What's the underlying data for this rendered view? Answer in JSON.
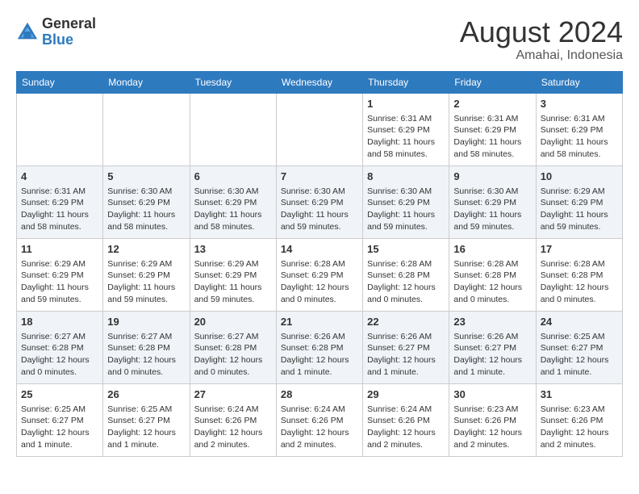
{
  "header": {
    "logo_general": "General",
    "logo_blue": "Blue",
    "title": "August 2024",
    "subtitle": "Amahai, Indonesia"
  },
  "days_of_week": [
    "Sunday",
    "Monday",
    "Tuesday",
    "Wednesday",
    "Thursday",
    "Friday",
    "Saturday"
  ],
  "weeks": [
    [
      {
        "day": "",
        "info": ""
      },
      {
        "day": "",
        "info": ""
      },
      {
        "day": "",
        "info": ""
      },
      {
        "day": "",
        "info": ""
      },
      {
        "day": "1",
        "info": "Sunrise: 6:31 AM\nSunset: 6:29 PM\nDaylight: 11 hours\nand 58 minutes."
      },
      {
        "day": "2",
        "info": "Sunrise: 6:31 AM\nSunset: 6:29 PM\nDaylight: 11 hours\nand 58 minutes."
      },
      {
        "day": "3",
        "info": "Sunrise: 6:31 AM\nSunset: 6:29 PM\nDaylight: 11 hours\nand 58 minutes."
      }
    ],
    [
      {
        "day": "4",
        "info": "Sunrise: 6:31 AM\nSunset: 6:29 PM\nDaylight: 11 hours\nand 58 minutes."
      },
      {
        "day": "5",
        "info": "Sunrise: 6:30 AM\nSunset: 6:29 PM\nDaylight: 11 hours\nand 58 minutes."
      },
      {
        "day": "6",
        "info": "Sunrise: 6:30 AM\nSunset: 6:29 PM\nDaylight: 11 hours\nand 58 minutes."
      },
      {
        "day": "7",
        "info": "Sunrise: 6:30 AM\nSunset: 6:29 PM\nDaylight: 11 hours\nand 59 minutes."
      },
      {
        "day": "8",
        "info": "Sunrise: 6:30 AM\nSunset: 6:29 PM\nDaylight: 11 hours\nand 59 minutes."
      },
      {
        "day": "9",
        "info": "Sunrise: 6:30 AM\nSunset: 6:29 PM\nDaylight: 11 hours\nand 59 minutes."
      },
      {
        "day": "10",
        "info": "Sunrise: 6:29 AM\nSunset: 6:29 PM\nDaylight: 11 hours\nand 59 minutes."
      }
    ],
    [
      {
        "day": "11",
        "info": "Sunrise: 6:29 AM\nSunset: 6:29 PM\nDaylight: 11 hours\nand 59 minutes."
      },
      {
        "day": "12",
        "info": "Sunrise: 6:29 AM\nSunset: 6:29 PM\nDaylight: 11 hours\nand 59 minutes."
      },
      {
        "day": "13",
        "info": "Sunrise: 6:29 AM\nSunset: 6:29 PM\nDaylight: 11 hours\nand 59 minutes."
      },
      {
        "day": "14",
        "info": "Sunrise: 6:28 AM\nSunset: 6:29 PM\nDaylight: 12 hours\nand 0 minutes."
      },
      {
        "day": "15",
        "info": "Sunrise: 6:28 AM\nSunset: 6:28 PM\nDaylight: 12 hours\nand 0 minutes."
      },
      {
        "day": "16",
        "info": "Sunrise: 6:28 AM\nSunset: 6:28 PM\nDaylight: 12 hours\nand 0 minutes."
      },
      {
        "day": "17",
        "info": "Sunrise: 6:28 AM\nSunset: 6:28 PM\nDaylight: 12 hours\nand 0 minutes."
      }
    ],
    [
      {
        "day": "18",
        "info": "Sunrise: 6:27 AM\nSunset: 6:28 PM\nDaylight: 12 hours\nand 0 minutes."
      },
      {
        "day": "19",
        "info": "Sunrise: 6:27 AM\nSunset: 6:28 PM\nDaylight: 12 hours\nand 0 minutes."
      },
      {
        "day": "20",
        "info": "Sunrise: 6:27 AM\nSunset: 6:28 PM\nDaylight: 12 hours\nand 0 minutes."
      },
      {
        "day": "21",
        "info": "Sunrise: 6:26 AM\nSunset: 6:28 PM\nDaylight: 12 hours\nand 1 minute."
      },
      {
        "day": "22",
        "info": "Sunrise: 6:26 AM\nSunset: 6:27 PM\nDaylight: 12 hours\nand 1 minute."
      },
      {
        "day": "23",
        "info": "Sunrise: 6:26 AM\nSunset: 6:27 PM\nDaylight: 12 hours\nand 1 minute."
      },
      {
        "day": "24",
        "info": "Sunrise: 6:25 AM\nSunset: 6:27 PM\nDaylight: 12 hours\nand 1 minute."
      }
    ],
    [
      {
        "day": "25",
        "info": "Sunrise: 6:25 AM\nSunset: 6:27 PM\nDaylight: 12 hours\nand 1 minute."
      },
      {
        "day": "26",
        "info": "Sunrise: 6:25 AM\nSunset: 6:27 PM\nDaylight: 12 hours\nand 1 minute."
      },
      {
        "day": "27",
        "info": "Sunrise: 6:24 AM\nSunset: 6:26 PM\nDaylight: 12 hours\nand 2 minutes."
      },
      {
        "day": "28",
        "info": "Sunrise: 6:24 AM\nSunset: 6:26 PM\nDaylight: 12 hours\nand 2 minutes."
      },
      {
        "day": "29",
        "info": "Sunrise: 6:24 AM\nSunset: 6:26 PM\nDaylight: 12 hours\nand 2 minutes."
      },
      {
        "day": "30",
        "info": "Sunrise: 6:23 AM\nSunset: 6:26 PM\nDaylight: 12 hours\nand 2 minutes."
      },
      {
        "day": "31",
        "info": "Sunrise: 6:23 AM\nSunset: 6:26 PM\nDaylight: 12 hours\nand 2 minutes."
      }
    ]
  ]
}
